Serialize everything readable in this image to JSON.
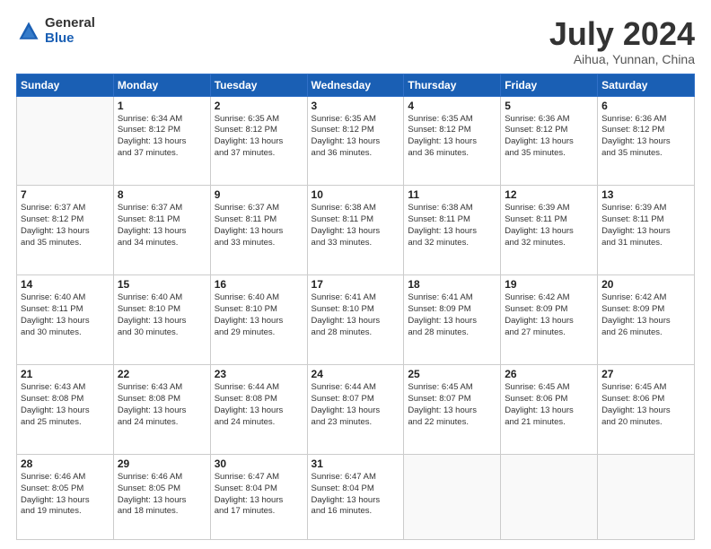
{
  "logo": {
    "general": "General",
    "blue": "Blue"
  },
  "header": {
    "title": "July 2024",
    "subtitle": "Aihua, Yunnan, China"
  },
  "weekdays": [
    "Sunday",
    "Monday",
    "Tuesday",
    "Wednesday",
    "Thursday",
    "Friday",
    "Saturday"
  ],
  "weeks": [
    [
      {
        "day": "",
        "empty": true
      },
      {
        "day": "1",
        "sunrise": "6:34 AM",
        "sunset": "8:12 PM",
        "daylight": "13 hours and 37 minutes."
      },
      {
        "day": "2",
        "sunrise": "6:35 AM",
        "sunset": "8:12 PM",
        "daylight": "13 hours and 37 minutes."
      },
      {
        "day": "3",
        "sunrise": "6:35 AM",
        "sunset": "8:12 PM",
        "daylight": "13 hours and 36 minutes."
      },
      {
        "day": "4",
        "sunrise": "6:35 AM",
        "sunset": "8:12 PM",
        "daylight": "13 hours and 36 minutes."
      },
      {
        "day": "5",
        "sunrise": "6:36 AM",
        "sunset": "8:12 PM",
        "daylight": "13 hours and 35 minutes."
      },
      {
        "day": "6",
        "sunrise": "6:36 AM",
        "sunset": "8:12 PM",
        "daylight": "13 hours and 35 minutes."
      }
    ],
    [
      {
        "day": "7",
        "sunrise": "6:37 AM",
        "sunset": "8:12 PM",
        "daylight": "13 hours and 35 minutes."
      },
      {
        "day": "8",
        "sunrise": "6:37 AM",
        "sunset": "8:11 PM",
        "daylight": "13 hours and 34 minutes."
      },
      {
        "day": "9",
        "sunrise": "6:37 AM",
        "sunset": "8:11 PM",
        "daylight": "13 hours and 33 minutes."
      },
      {
        "day": "10",
        "sunrise": "6:38 AM",
        "sunset": "8:11 PM",
        "daylight": "13 hours and 33 minutes."
      },
      {
        "day": "11",
        "sunrise": "6:38 AM",
        "sunset": "8:11 PM",
        "daylight": "13 hours and 32 minutes."
      },
      {
        "day": "12",
        "sunrise": "6:39 AM",
        "sunset": "8:11 PM",
        "daylight": "13 hours and 32 minutes."
      },
      {
        "day": "13",
        "sunrise": "6:39 AM",
        "sunset": "8:11 PM",
        "daylight": "13 hours and 31 minutes."
      }
    ],
    [
      {
        "day": "14",
        "sunrise": "6:40 AM",
        "sunset": "8:11 PM",
        "daylight": "13 hours and 30 minutes."
      },
      {
        "day": "15",
        "sunrise": "6:40 AM",
        "sunset": "8:10 PM",
        "daylight": "13 hours and 30 minutes."
      },
      {
        "day": "16",
        "sunrise": "6:40 AM",
        "sunset": "8:10 PM",
        "daylight": "13 hours and 29 minutes."
      },
      {
        "day": "17",
        "sunrise": "6:41 AM",
        "sunset": "8:10 PM",
        "daylight": "13 hours and 28 minutes."
      },
      {
        "day": "18",
        "sunrise": "6:41 AM",
        "sunset": "8:09 PM",
        "daylight": "13 hours and 28 minutes."
      },
      {
        "day": "19",
        "sunrise": "6:42 AM",
        "sunset": "8:09 PM",
        "daylight": "13 hours and 27 minutes."
      },
      {
        "day": "20",
        "sunrise": "6:42 AM",
        "sunset": "8:09 PM",
        "daylight": "13 hours and 26 minutes."
      }
    ],
    [
      {
        "day": "21",
        "sunrise": "6:43 AM",
        "sunset": "8:08 PM",
        "daylight": "13 hours and 25 minutes."
      },
      {
        "day": "22",
        "sunrise": "6:43 AM",
        "sunset": "8:08 PM",
        "daylight": "13 hours and 24 minutes."
      },
      {
        "day": "23",
        "sunrise": "6:44 AM",
        "sunset": "8:08 PM",
        "daylight": "13 hours and 24 minutes."
      },
      {
        "day": "24",
        "sunrise": "6:44 AM",
        "sunset": "8:07 PM",
        "daylight": "13 hours and 23 minutes."
      },
      {
        "day": "25",
        "sunrise": "6:45 AM",
        "sunset": "8:07 PM",
        "daylight": "13 hours and 22 minutes."
      },
      {
        "day": "26",
        "sunrise": "6:45 AM",
        "sunset": "8:06 PM",
        "daylight": "13 hours and 21 minutes."
      },
      {
        "day": "27",
        "sunrise": "6:45 AM",
        "sunset": "8:06 PM",
        "daylight": "13 hours and 20 minutes."
      }
    ],
    [
      {
        "day": "28",
        "sunrise": "6:46 AM",
        "sunset": "8:05 PM",
        "daylight": "13 hours and 19 minutes."
      },
      {
        "day": "29",
        "sunrise": "6:46 AM",
        "sunset": "8:05 PM",
        "daylight": "13 hours and 18 minutes."
      },
      {
        "day": "30",
        "sunrise": "6:47 AM",
        "sunset": "8:04 PM",
        "daylight": "13 hours and 17 minutes."
      },
      {
        "day": "31",
        "sunrise": "6:47 AM",
        "sunset": "8:04 PM",
        "daylight": "13 hours and 16 minutes."
      },
      {
        "day": "",
        "empty": true
      },
      {
        "day": "",
        "empty": true
      },
      {
        "day": "",
        "empty": true
      }
    ]
  ]
}
